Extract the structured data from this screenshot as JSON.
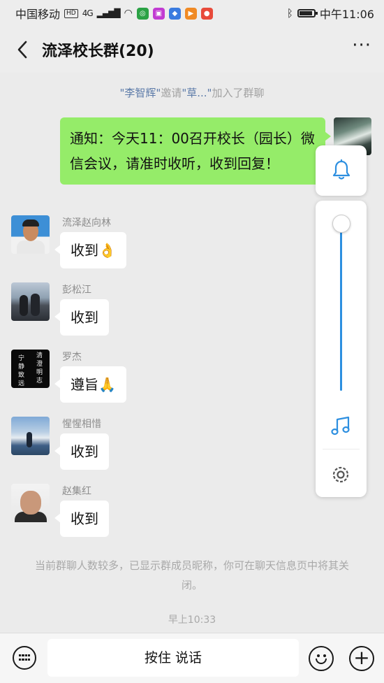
{
  "status_bar": {
    "carrier": "中国移动",
    "hd": "HD",
    "network": "4G",
    "time": "中午11:06"
  },
  "header": {
    "back": "‹",
    "title": "流泽校长群(20)",
    "more": "···"
  },
  "system_note": {
    "inviter": "\"李智辉\"",
    "action": "邀请",
    "invitee": "\"草...\"",
    "result": "加入了群聊"
  },
  "self_message": {
    "text": "通知：今天11：00召开校长（园长）微信会议，请准时收听，收到回复！"
  },
  "messages": [
    {
      "sender": "流泽赵向林",
      "text": "收到",
      "emoji": "👌"
    },
    {
      "sender": "彭松江",
      "text": "收到",
      "emoji": ""
    },
    {
      "sender": "罗杰",
      "text": "遵旨",
      "emoji": "🙏"
    },
    {
      "sender": "惺惺相惜",
      "text": "收到",
      "emoji": ""
    },
    {
      "sender": "赵集红",
      "text": "收到",
      "emoji": ""
    }
  ],
  "avatar3_text": [
    "清",
    "澄",
    "明",
    "志",
    "宁",
    "静",
    "致",
    "远"
  ],
  "info_note": "当前群聊人数较多，已显示群成员昵称，你可在聊天信息页中将其关闭。",
  "time_note": "早上10:33",
  "input_bar": {
    "voice_label": "按住 说话",
    "plus": "+"
  },
  "float_panel": {
    "volume_level": 0.0,
    "accent_color": "#2d8fe0"
  }
}
